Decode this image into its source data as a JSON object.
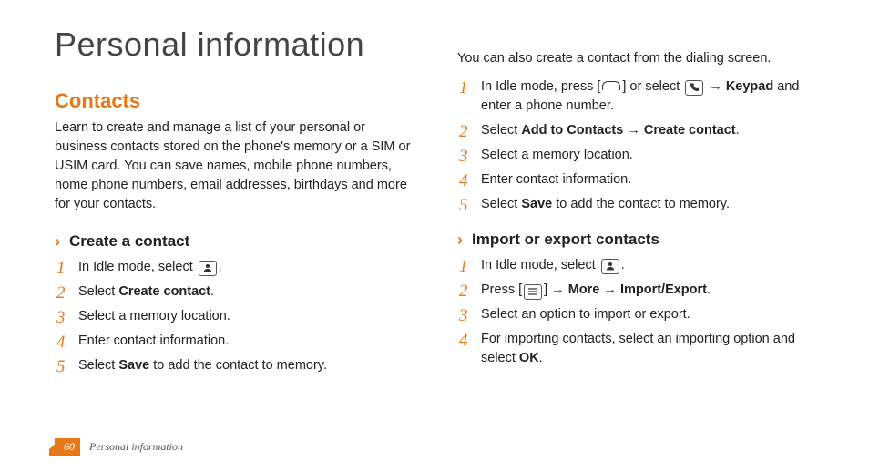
{
  "title": "Personal information",
  "left": {
    "section_title": "Contacts",
    "intro": "Learn to create and manage a list of your personal or business contacts stored on the phone's memory or a SIM or USIM card. You can save names, mobile phone numbers, home phone numbers, email addresses, birthdays and more for your contacts.",
    "sub1": {
      "heading": "Create a contact",
      "steps": {
        "s1a": "In Idle mode, select ",
        "s1b": ".",
        "s2a": "Select ",
        "s2b": "Create contact",
        "s2c": ".",
        "s3": "Select a memory location.",
        "s4": "Enter contact information.",
        "s5a": "Select ",
        "s5b": "Save",
        "s5c": " to add the contact to memory."
      }
    }
  },
  "right": {
    "lead": "You can also create a contact from the dialing screen.",
    "steps_a": {
      "s1a": "In Idle mode, press [",
      "s1b": "] or select ",
      "s1c": " → ",
      "s1d": "Keypad",
      "s1e": " and enter a phone number.",
      "s2a": "Select ",
      "s2b": "Add to Contacts",
      "s2c": " → ",
      "s2d": "Create contact",
      "s2e": ".",
      "s3": "Select a memory location.",
      "s4": "Enter contact information.",
      "s5a": "Select ",
      "s5b": "Save",
      "s5c": " to add the contact to memory."
    },
    "sub2": {
      "heading": "Import or export contacts",
      "steps": {
        "s1a": "In Idle mode, select ",
        "s1b": ".",
        "s2a": "Press [",
        "s2b": "] → ",
        "s2c": "More",
        "s2d": " → ",
        "s2e": "Import/Export",
        "s2f": ".",
        "s3": "Select an option to import or export.",
        "s4a": "For importing contacts, select an importing option and select ",
        "s4b": "OK",
        "s4c": "."
      }
    }
  },
  "footer": {
    "page": "60",
    "text": "Personal information"
  }
}
